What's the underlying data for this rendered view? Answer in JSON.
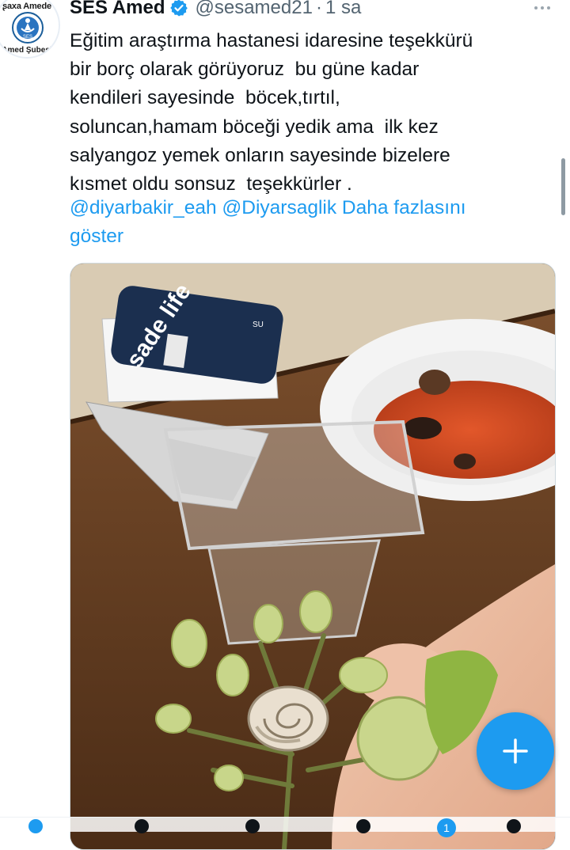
{
  "tweet": {
    "display_name": "SES Amed",
    "handle": "@sesamed21",
    "separator": "·",
    "time": "1 sa",
    "avatar": {
      "top_text": "ʂaxa Amede",
      "bottom_text": "Amed Şubesi",
      "emblem_text": "SES"
    },
    "text_lines": [
      "Eğitim araştırma hastanesi idaresine teşekkürü",
      "bir borç olarak görüyoruz  bu güne kadar",
      "kendileri sayesinde  böcek,tırtıl,",
      "soluncan,hamam böceği yedik ama  ilk kez",
      "salyangoz yemek onların sayesinde bizelere",
      "kısmet oldu sonsuz  teşekkürler ."
    ],
    "mention_1": "@diyarbakir_eah",
    "mention_2": "@Diyarsaglik",
    "show_more": "Daha fazlasını",
    "show_more_2": "göster",
    "media": {
      "cup_brand": "sade life",
      "cup_small_text": "SU"
    }
  },
  "fab": {
    "icon": "plus-icon"
  },
  "bottom_nav": {
    "badge_count": "1"
  },
  "colors": {
    "accent": "#1d9bf0",
    "text": "#0f1419",
    "muted": "#536471"
  }
}
